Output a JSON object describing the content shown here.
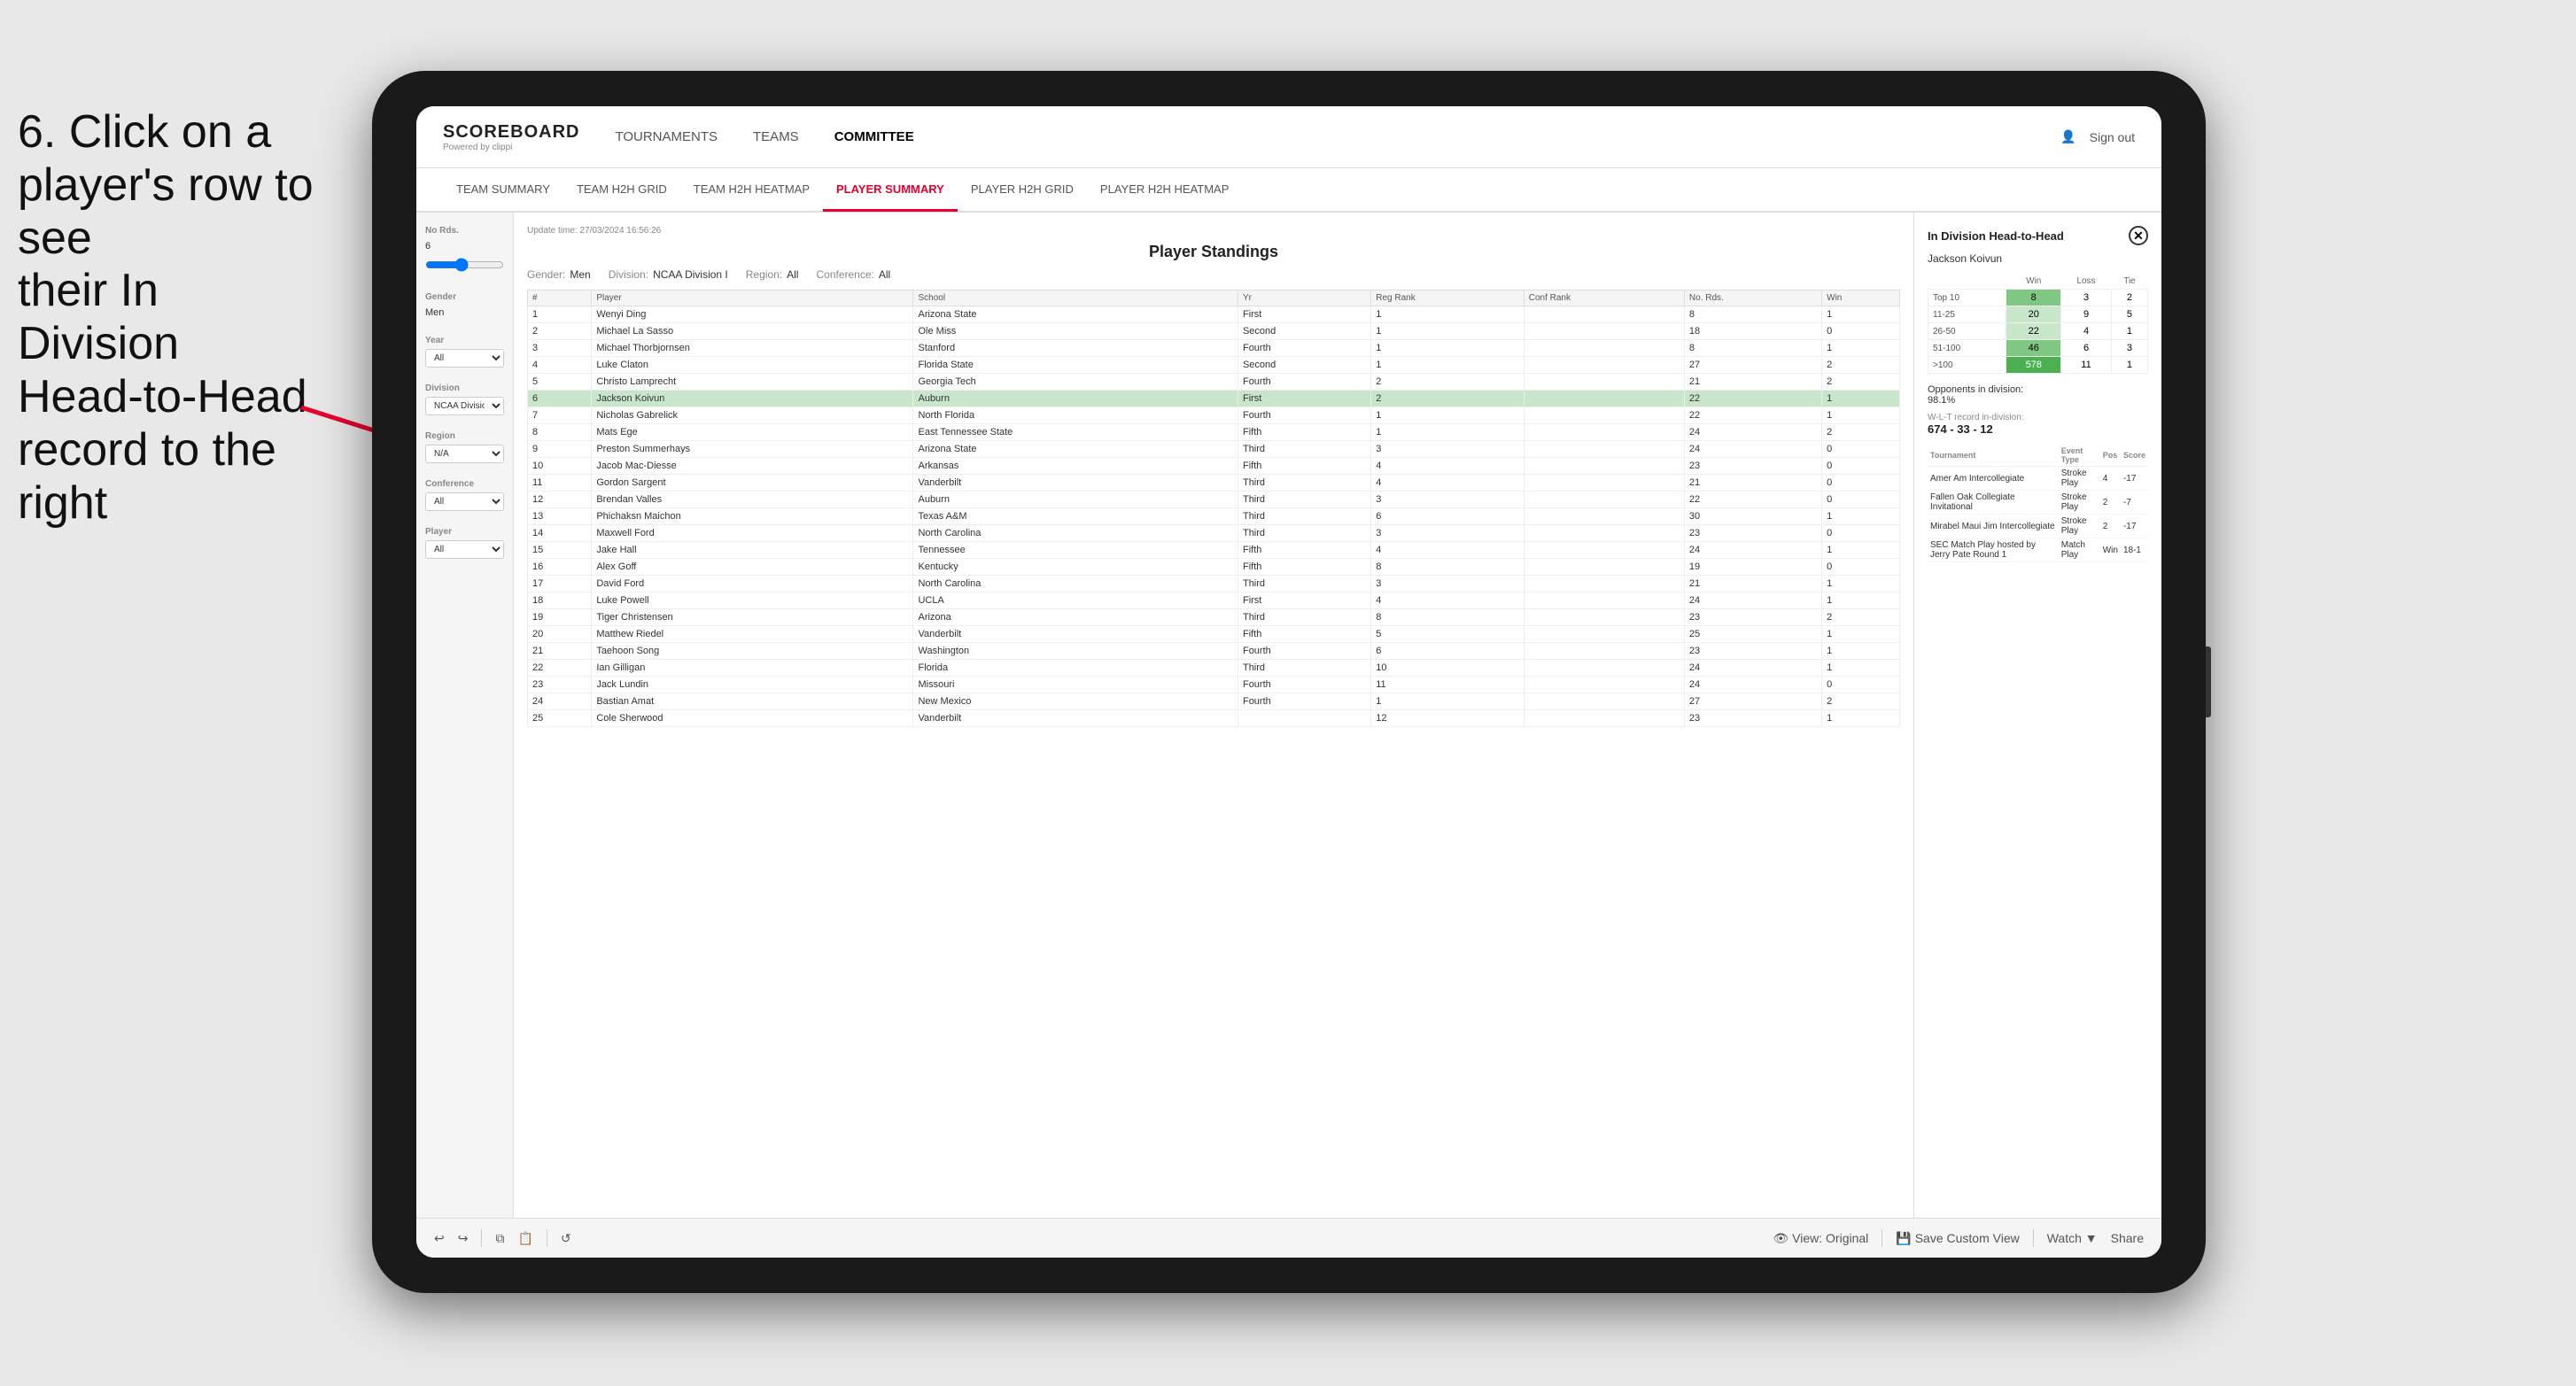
{
  "instruction": {
    "line1": "6. Click on a",
    "line2": "player's row to see",
    "line3": "their In Division",
    "line4": "Head-to-Head",
    "line5": "record to the right"
  },
  "nav": {
    "logo_title": "SCOREBOARD",
    "logo_subtitle": "Powered by clippi",
    "links": [
      "TOURNAMENTS",
      "TEAMS",
      "COMMITTEE"
    ],
    "sign_out": "Sign out"
  },
  "sub_nav": {
    "links": [
      "TEAM SUMMARY",
      "TEAM H2H GRID",
      "TEAM H2H HEATMAP",
      "PLAYER SUMMARY",
      "PLAYER H2H GRID",
      "PLAYER H2H HEATMAP"
    ],
    "active": "PLAYER SUMMARY"
  },
  "sidebar": {
    "no_rds_label": "No Rds.",
    "no_rds_value": "6",
    "gender_label": "Gender",
    "gender_value": "Men",
    "year_label": "Year",
    "year_value": "(All)",
    "division_label": "Division",
    "division_value": "NCAA Division I",
    "region_label": "Region",
    "region_value": "N/A",
    "conference_label": "Conference",
    "conference_value": "(All)",
    "player_label": "Player",
    "player_value": "(All)"
  },
  "panel": {
    "update_time": "Update time:",
    "update_date": "27/03/2024 16:56:26",
    "title": "Player Standings",
    "gender_label": "Gender:",
    "gender_value": "Men",
    "division_label": "Division:",
    "division_value": "NCAA Division I",
    "region_label": "Region:",
    "region_value": "All",
    "conference_label": "Conference:",
    "conference_value": "All"
  },
  "table": {
    "headers": [
      "#",
      "Player",
      "School",
      "Yr",
      "Reg Rank",
      "Conf Rank",
      "No. Rds.",
      "Win"
    ],
    "rows": [
      {
        "num": 1,
        "player": "Wenyi Ding",
        "school": "Arizona State",
        "yr": "First",
        "reg": 1,
        "conf": "",
        "rds": 8,
        "win": 1
      },
      {
        "num": 2,
        "player": "Michael La Sasso",
        "school": "Ole Miss",
        "yr": "Second",
        "reg": 1,
        "conf": "",
        "rds": 18,
        "win": 0
      },
      {
        "num": 3,
        "player": "Michael Thorbjornsen",
        "school": "Stanford",
        "yr": "Fourth",
        "reg": 1,
        "conf": "",
        "rds": 8,
        "win": 1
      },
      {
        "num": 4,
        "player": "Luke Claton",
        "school": "Florida State",
        "yr": "Second",
        "reg": 1,
        "conf": "",
        "rds": 27,
        "win": 2
      },
      {
        "num": 5,
        "player": "Christo Lamprecht",
        "school": "Georgia Tech",
        "yr": "Fourth",
        "reg": 2,
        "conf": "",
        "rds": 21,
        "win": 2
      },
      {
        "num": 6,
        "player": "Jackson Koivun",
        "school": "Auburn",
        "yr": "First",
        "reg": 2,
        "conf": "",
        "rds": 22,
        "win": 1,
        "highlighted": true
      },
      {
        "num": 7,
        "player": "Nicholas Gabrelick",
        "school": "North Florida",
        "yr": "Fourth",
        "reg": 1,
        "conf": "",
        "rds": 22,
        "win": 1
      },
      {
        "num": 8,
        "player": "Mats Ege",
        "school": "East Tennessee State",
        "yr": "Fifth",
        "reg": 1,
        "conf": "",
        "rds": 24,
        "win": 2
      },
      {
        "num": 9,
        "player": "Preston Summerhays",
        "school": "Arizona State",
        "yr": "Third",
        "reg": 3,
        "conf": "",
        "rds": 24,
        "win": 0
      },
      {
        "num": 10,
        "player": "Jacob Mac-Diesse",
        "school": "Arkansas",
        "yr": "Fifth",
        "reg": 4,
        "conf": "",
        "rds": 23,
        "win": 0
      },
      {
        "num": 11,
        "player": "Gordon Sargent",
        "school": "Vanderbilt",
        "yr": "Third",
        "reg": 4,
        "conf": "",
        "rds": 21,
        "win": 0
      },
      {
        "num": 12,
        "player": "Brendan Valles",
        "school": "Auburn",
        "yr": "Third",
        "reg": 3,
        "conf": "",
        "rds": 22,
        "win": 0
      },
      {
        "num": 13,
        "player": "Phichaksn Maichon",
        "school": "Texas A&M",
        "yr": "Third",
        "reg": 6,
        "conf": "",
        "rds": 30,
        "win": 1
      },
      {
        "num": 14,
        "player": "Maxwell Ford",
        "school": "North Carolina",
        "yr": "Third",
        "reg": 3,
        "conf": "",
        "rds": 23,
        "win": 0
      },
      {
        "num": 15,
        "player": "Jake Hall",
        "school": "Tennessee",
        "yr": "Fifth",
        "reg": 4,
        "conf": "",
        "rds": 24,
        "win": 1
      },
      {
        "num": 16,
        "player": "Alex Goff",
        "school": "Kentucky",
        "yr": "Fifth",
        "reg": 8,
        "conf": "",
        "rds": 19,
        "win": 0
      },
      {
        "num": 17,
        "player": "David Ford",
        "school": "North Carolina",
        "yr": "Third",
        "reg": 3,
        "conf": "",
        "rds": 21,
        "win": 1
      },
      {
        "num": 18,
        "player": "Luke Powell",
        "school": "UCLA",
        "yr": "First",
        "reg": 4,
        "conf": "",
        "rds": 24,
        "win": 1
      },
      {
        "num": 19,
        "player": "Tiger Christensen",
        "school": "Arizona",
        "yr": "Third",
        "reg": 8,
        "conf": "",
        "rds": 23,
        "win": 2
      },
      {
        "num": 20,
        "player": "Matthew Riedel",
        "school": "Vanderbilt",
        "yr": "Fifth",
        "reg": 5,
        "conf": "",
        "rds": 25,
        "win": 1
      },
      {
        "num": 21,
        "player": "Taehoon Song",
        "school": "Washington",
        "yr": "Fourth",
        "reg": 6,
        "conf": "",
        "rds": 23,
        "win": 1
      },
      {
        "num": 22,
        "player": "Ian Gilligan",
        "school": "Florida",
        "yr": "Third",
        "reg": 10,
        "conf": "",
        "rds": 24,
        "win": 1
      },
      {
        "num": 23,
        "player": "Jack Lundin",
        "school": "Missouri",
        "yr": "Fourth",
        "reg": 11,
        "conf": "",
        "rds": 24,
        "win": 0
      },
      {
        "num": 24,
        "player": "Bastian Amat",
        "school": "New Mexico",
        "yr": "Fourth",
        "reg": 1,
        "conf": "",
        "rds": 27,
        "win": 2
      },
      {
        "num": 25,
        "player": "Cole Sherwood",
        "school": "Vanderbilt",
        "yr": "",
        "reg": 12,
        "conf": "",
        "rds": 23,
        "win": 1
      }
    ]
  },
  "h2h_panel": {
    "title": "In Division Head-to-Head",
    "player_name": "Jackson Koivun",
    "col_headers": [
      "Win",
      "Loss",
      "Tie"
    ],
    "rows": [
      {
        "rank": "Top 10",
        "win": 8,
        "loss": 3,
        "tie": 2,
        "win_shade": "medium"
      },
      {
        "rank": "11-25",
        "win": 20,
        "loss": 9,
        "tie": 5,
        "win_shade": "light"
      },
      {
        "rank": "26-50",
        "win": 22,
        "loss": 4,
        "tie": 1,
        "win_shade": "light"
      },
      {
        "rank": "51-100",
        "win": 46,
        "loss": 6,
        "tie": 3,
        "win_shade": "medium"
      },
      {
        "rank": ">100",
        "win": 578,
        "loss": 11,
        "tie": 1,
        "win_shade": "dark"
      }
    ],
    "opp_pct_label": "Opponents in division:",
    "opp_pct": "98.1%",
    "wlt_label": "W-L-T record in-division:",
    "wlt_record": "674 - 33 - 12",
    "tournament_headers": [
      "Tournament",
      "Event Type",
      "Pos",
      "Score"
    ],
    "tournaments": [
      {
        "name": "Amer Am Intercollegiate",
        "type": "Stroke Play",
        "pos": 4,
        "score": "-17"
      },
      {
        "name": "Fallen Oak Collegiate Invitational",
        "type": "Stroke Play",
        "pos": 2,
        "score": "-7"
      },
      {
        "name": "Mirabel Maui Jim Intercollegiate",
        "type": "Stroke Play",
        "pos": 2,
        "score": "-17"
      },
      {
        "name": "SEC Match Play hosted by Jerry Pate Round 1",
        "type": "Match Play",
        "pos": "Win",
        "score": "18-1"
      }
    ]
  },
  "toolbar": {
    "undo": "↩",
    "redo": "↪",
    "view_original": "View: Original",
    "save_custom": "Save Custom View",
    "watch": "Watch ▼",
    "share": "Share"
  }
}
